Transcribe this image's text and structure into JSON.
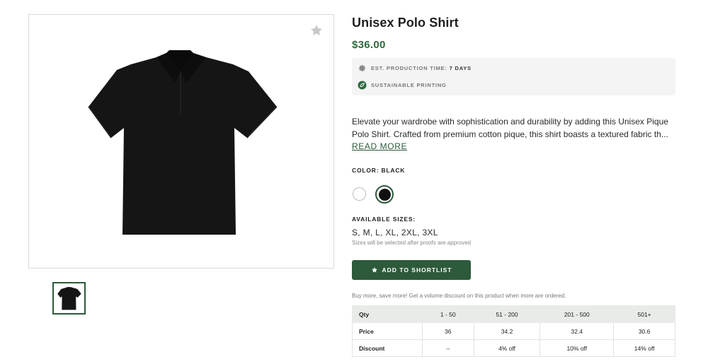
{
  "product": {
    "title": "Unisex Polo Shirt",
    "price": "$36.00",
    "image_subject": "black-polo-shirt"
  },
  "info": {
    "production_label": "EST. PRODUCTION TIME:",
    "production_value": "7 DAYS",
    "sustainable_label": "SUSTAINABLE PRINTING"
  },
  "description": {
    "line1": "Elevate your wardrobe with sophistication and durability by adding this Unisex Pique",
    "line2": "Polo Shirt. Crafted from premium cotton pique, this shirt boasts a textured fabric th...",
    "read_more": "READ MORE"
  },
  "color": {
    "label": "COLOR: BLACK",
    "options": [
      "white",
      "black"
    ],
    "selected": "black"
  },
  "sizes": {
    "label": "AVAILABLE SIZES:",
    "values": "S, M, L, XL, 2XL, 3XL",
    "note": "Sizes will be selected after proofs are approved"
  },
  "shortlist_button": "ADD TO SHORTLIST",
  "volume_note": "Buy more, save more! Get a volume discount on this product when more are ordered.",
  "pricing_table": {
    "header": [
      "Qty",
      "1 - 50",
      "51 - 200",
      "201 - 500",
      "501+"
    ],
    "rows": [
      [
        "Price",
        "36",
        "34.2",
        "32.4",
        "30.6"
      ],
      [
        "Discount",
        "--",
        "4% off",
        "10% off",
        "14% off"
      ]
    ]
  },
  "colors": {
    "accent": "#2d5a3a",
    "price": "#2d6a3e",
    "info_bg": "#f4f4f4",
    "table_header_bg": "#e8ebe8"
  },
  "icons": {
    "favorite": "star-icon",
    "production": "gear-icon",
    "sustainable": "leaf-icon",
    "shortlist": "star-icon"
  }
}
